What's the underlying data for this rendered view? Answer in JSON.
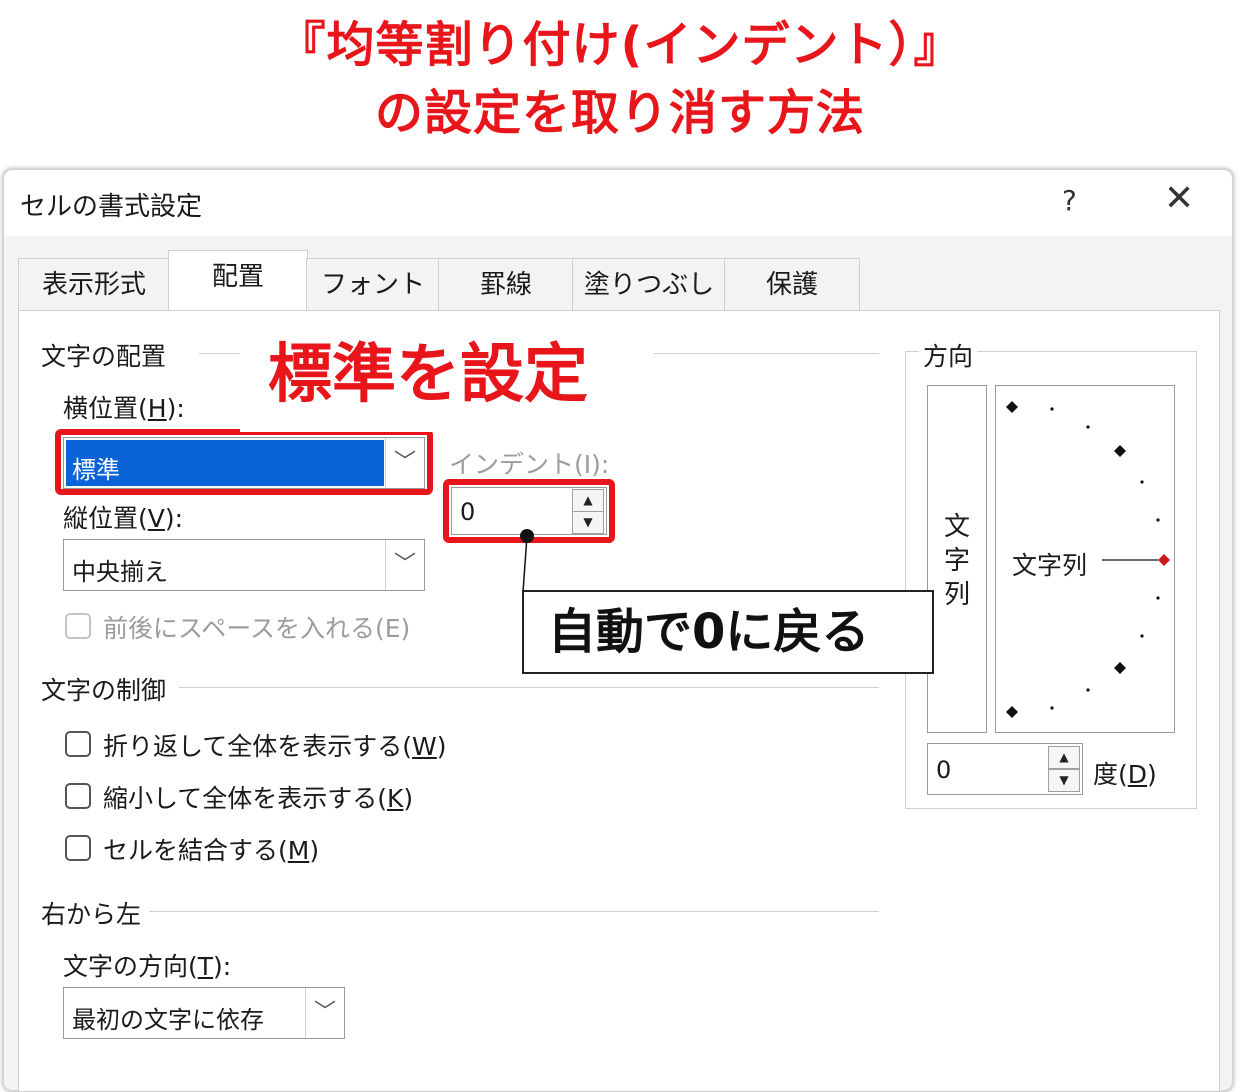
{
  "headline": {
    "line1": "『均等割り付け(インデント）』",
    "line2": "の設定を取り消す方法"
  },
  "dialog": {
    "title": "セルの書式設定",
    "help": "?",
    "close": "✕"
  },
  "tabs": [
    {
      "label": "表示形式"
    },
    {
      "label": "配置"
    },
    {
      "label": "フォント"
    },
    {
      "label": "罫線"
    },
    {
      "label": "塗りつぶし"
    },
    {
      "label": "保護"
    }
  ],
  "active_tab": "配置",
  "text_alignment": {
    "section": "文字の配置",
    "horizontal": {
      "label_pre": "横位置(",
      "accel": "H",
      "label_post": "):",
      "value": "標準"
    },
    "vertical": {
      "label_pre": "縦位置(",
      "accel": "V",
      "label_post": "):",
      "value": "中央揃え"
    },
    "indent": {
      "label": "インデント(I):",
      "value": "0"
    },
    "space_before_after": "前後にスペースを入れる(E)"
  },
  "text_control": {
    "section": "文字の制御",
    "wrap": {
      "pre": "折り返して全体を表示する(",
      "accel": "W",
      "post": ")",
      "checked": false
    },
    "shrink": {
      "pre": "縮小して全体を表示する(",
      "accel": "K",
      "post": ")",
      "checked": false
    },
    "merge": {
      "pre": "セルを結合する(",
      "accel": "M",
      "post": ")",
      "checked": false
    }
  },
  "right_to_left": {
    "section": "右から左",
    "direction": {
      "label_pre": "文字の方向(",
      "accel": "T",
      "label_post": "):",
      "value": "最初の文字に依存"
    }
  },
  "orientation": {
    "section": "方向",
    "vertical_text": [
      "文",
      "字",
      "列"
    ],
    "rotated_label": "文字列",
    "degrees_value": "0",
    "degrees_pre": "度(",
    "degrees_accel": "D",
    "degrees_post": ")"
  },
  "annotations": {
    "set_standard": "標準を設定",
    "auto_zero": "自動で0に戻る",
    "highlight_color": "#e8161b",
    "selection_color": "#0a64d8"
  },
  "icons": {
    "dropdown": "chevron-down-icon",
    "spin_up": "triangle-up-icon",
    "spin_down": "triangle-down-icon"
  }
}
